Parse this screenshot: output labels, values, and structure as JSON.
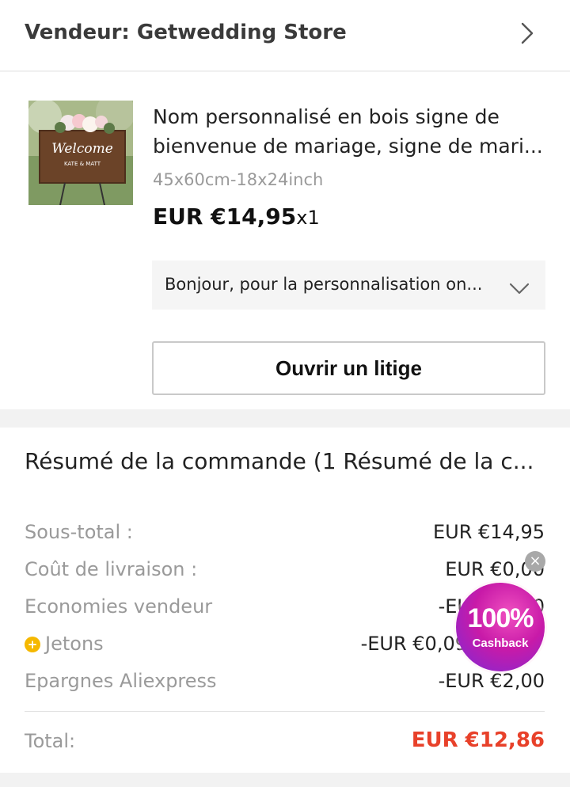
{
  "seller": {
    "label": "Vendeur: Getwedding Store"
  },
  "product": {
    "title_line1": "Nom personnalisé en bois signe de",
    "title_line2": "bienvenue de mariage, signe de mari...",
    "variant": "45x60cm-18x24inch",
    "price": "EUR €14,95",
    "quantity": "x1",
    "image_text": "Welcome",
    "image_subtext": "KATE & MATT"
  },
  "note": {
    "text": "Bonjour, pour la personnalisation on..."
  },
  "actions": {
    "dispute_label": "Ouvrir un litige"
  },
  "summary": {
    "title": "Résumé de la commande (1 Résumé de la c...",
    "rows": [
      {
        "label": "Sous-total :",
        "value": "EUR €14,95"
      },
      {
        "label": "Coût de livraison :",
        "value": "EUR €0,00"
      },
      {
        "label": "Economies vendeur",
        "value": "-EUR €0,00"
      },
      {
        "label": "Jetons",
        "value": "-EUR €0,09"
      },
      {
        "label": "Epargnes Aliexpress",
        "value": "-EUR €2,00"
      }
    ],
    "total_label": "Total:",
    "total_value": "EUR €12,86"
  },
  "cashback": {
    "percent": "100%",
    "label": "Cashback"
  },
  "colors": {
    "total": "#e8412a",
    "coin": "#f5b800",
    "cashback": "#c81aa8"
  }
}
